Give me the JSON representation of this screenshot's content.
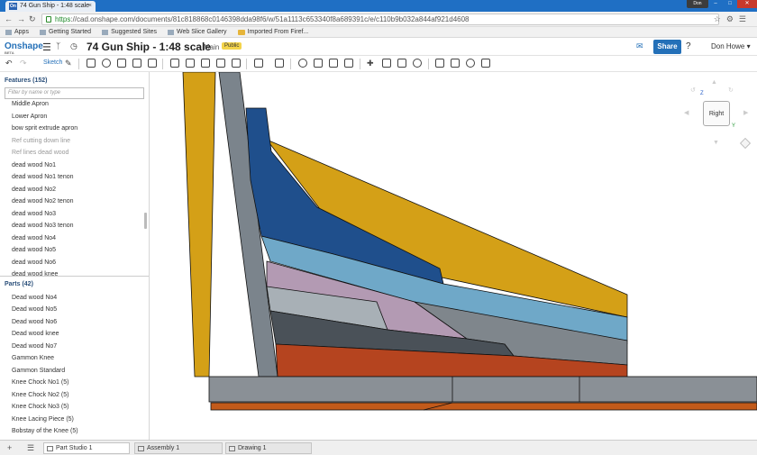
{
  "browser": {
    "tab_title": "74 Gun Ship - 1:48 scale",
    "favicon": "On",
    "tab_close": "×",
    "user_badge": "Don",
    "url_https": "https",
    "url_rest": "://cad.onshape.com/documents/81c818868c0146398dda98f6/w/51a1113c653340f8a689391c/e/c110b9b032a844af921d4608",
    "bookmarks": [
      "Apps",
      "Getting Started",
      "Suggested Sites",
      "Web Slice Gallery",
      "Imported From Firef..."
    ]
  },
  "app": {
    "logo": "Onshape",
    "logo_sub": "BETA",
    "document_title": "74 Gun Ship - 1:48 scale",
    "branch": "Main",
    "visibility_badge": "Public",
    "share_label": "Share",
    "help_label": "?",
    "user_name": "Don Howe"
  },
  "toolbar": {
    "sketch_label": "Sketch"
  },
  "features": {
    "header": "Features (152)",
    "filter_placeholder": "Filter by name or type",
    "items": [
      {
        "label": "Middle Apron",
        "dim": false
      },
      {
        "label": "Lower Apron",
        "dim": false
      },
      {
        "label": "bow sprit extrude apron",
        "dim": false
      },
      {
        "label": "Ref cutting down line",
        "dim": true
      },
      {
        "label": "Ref lines dead wood",
        "dim": true
      },
      {
        "label": "dead wood No1",
        "dim": false
      },
      {
        "label": "dead wood No1 tenon",
        "dim": false
      },
      {
        "label": "dead wood No2",
        "dim": false
      },
      {
        "label": "dead wood No2 tenon",
        "dim": false
      },
      {
        "label": "dead wood No3",
        "dim": false
      },
      {
        "label": "dead wood No3 tenon",
        "dim": false
      },
      {
        "label": "dead wood No4",
        "dim": false
      },
      {
        "label": "dead wood No5",
        "dim": false
      },
      {
        "label": "dead wood No6",
        "dim": false
      },
      {
        "label": "dead wood knee",
        "dim": false
      }
    ]
  },
  "parts": {
    "header": "Parts (42)",
    "items": [
      "Dead wood No4",
      "Dead wood No5",
      "Dead wood No6",
      "Dead wood knee",
      "Dead wood No7",
      "Gammon Knee",
      "Gammon Standard",
      "Knee Chock No1 (5)",
      "Knee Chock No2 (5)",
      "Knee Chock No3 (5)",
      "Knee Lacing Piece (5)",
      "Bobstay of the Knee (5)"
    ]
  },
  "viewcube": {
    "face_label": "Right",
    "axis_z": "Z",
    "axis_y": "Y"
  },
  "bottom_tabs": [
    {
      "label": "Part Studio 1",
      "active": true
    },
    {
      "label": "Assembly 1",
      "active": false
    },
    {
      "label": "Drawing 1",
      "active": false
    }
  ],
  "colors": {
    "gold": "#d4a017",
    "grey_post": "#7b848c",
    "dark_blue": "#1f4f8c",
    "light_blue": "#6fa8c8",
    "mauve": "#b39ab3",
    "light_grey": "#a8b0b6",
    "dark_grey": "#4a5158",
    "rust": "#b5441f",
    "keel_grey": "#8a9096",
    "keel_orange": "#c25a1a",
    "accent": "#2470b8"
  }
}
